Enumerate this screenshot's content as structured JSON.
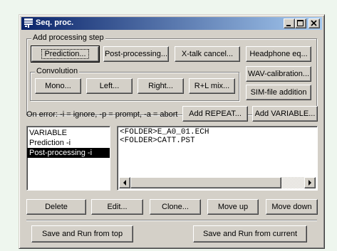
{
  "window": {
    "title": "Seq. proc."
  },
  "add_step": {
    "group_label": "Add processing step",
    "prediction": "Prediction...",
    "post_processing": "Post-processing...",
    "xtalk_cancel": "X-talk cancel...",
    "headphone_eq": "Headphone eq...",
    "wav_calibration": "WAV-calibration...",
    "sim_file_addition": "SIM-file addition"
  },
  "convolution": {
    "group_label": "Convolution",
    "mono": "Mono...",
    "left": "Left...",
    "right": "Right...",
    "rl_mix": "R+L mix..."
  },
  "on_error": {
    "text": "On error: -i = ignore, -p = prompt, -a = abort"
  },
  "add_repeat": "Add REPEAT...",
  "add_variable": "Add VARIABLE...",
  "steps_list": {
    "items": [
      "VARIABLE",
      "Prediction -i",
      "Post-processing -i"
    ]
  },
  "details_box": {
    "lines": [
      "<FOLDER>E_A0_01.ECH",
      "<FOLDER>CATT.PST"
    ]
  },
  "actions": {
    "delete": "Delete",
    "edit": "Edit...",
    "clone": "Clone...",
    "move_up": "Move up",
    "move_down": "Move down"
  },
  "run": {
    "from_top": "Save and Run from top",
    "from_current": "Save and Run from current"
  }
}
